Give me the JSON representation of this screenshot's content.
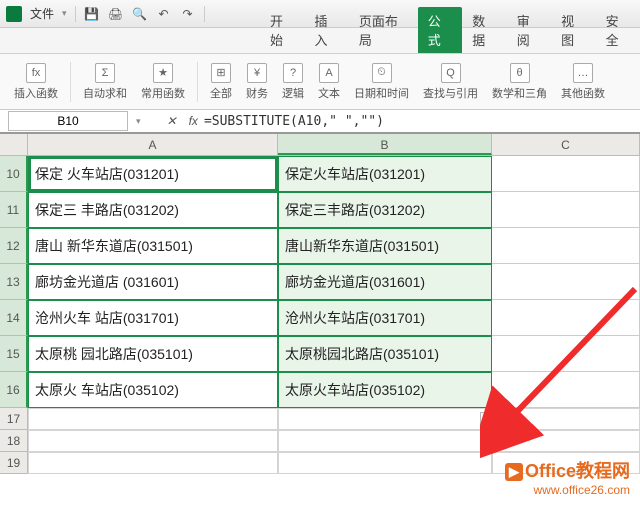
{
  "titlebar": {
    "file_label": "文件",
    "qa": {
      "save": "💾",
      "print": "🖨",
      "preview": "🔍",
      "undo": "↶",
      "redo": "↷"
    }
  },
  "ribbon_tabs": {
    "start": "开始",
    "insert": "插入",
    "layout": "页面布局",
    "formula": "公式",
    "data": "数据",
    "review": "审阅",
    "view": "视图",
    "security": "安全"
  },
  "ribbon_groups": {
    "insert_fn": {
      "icon": "fx",
      "label": "插入函数"
    },
    "autosum": {
      "icon": "Σ",
      "label": "自动求和"
    },
    "common": {
      "icon": "★",
      "label": "常用函数"
    },
    "all": {
      "icon": "⊞",
      "label": "全部"
    },
    "finance": {
      "icon": "¥",
      "label": "财务"
    },
    "logic": {
      "icon": "?",
      "label": "逻辑"
    },
    "text": {
      "icon": "A",
      "label": "文本"
    },
    "datetime": {
      "icon": "⏲",
      "label": "日期和时间"
    },
    "lookup": {
      "icon": "Q",
      "label": "查找与引用"
    },
    "math": {
      "icon": "θ",
      "label": "数学和三角"
    },
    "other": {
      "icon": "…",
      "label": "其他函数"
    }
  },
  "namebox": "B10",
  "formula": "=SUBSTITUTE(A10,\" \",\"\")",
  "columns": {
    "a": "A",
    "b": "B",
    "c": "C"
  },
  "rows": [
    {
      "n": "10",
      "a": "保定  火车站店(031201)",
      "b": "保定火车站店(031201)"
    },
    {
      "n": "11",
      "a": "保定三   丰路店(031202)",
      "b": "保定三丰路店(031202)"
    },
    {
      "n": "12",
      "a": "唐山   新华东道店(031501)",
      "b": "唐山新华东道店(031501)"
    },
    {
      "n": "13",
      "a": "廊坊金光道店   (031601)",
      "b": "廊坊金光道店(031601)"
    },
    {
      "n": "14",
      "a": "沧州火车   站店(031701)",
      "b": "沧州火车站店(031701)"
    },
    {
      "n": "15",
      "a": "太原桃    园北路店(035101)",
      "b": "太原桃园北路店(035101)"
    },
    {
      "n": "16",
      "a": "太原火   车站店(035102)",
      "b": "太原火车站店(035102)"
    }
  ],
  "empty_rows": [
    "17",
    "18",
    "19"
  ],
  "smarttag": "眠",
  "watermark": {
    "line1": "Office教程网",
    "line2": "www.office26.com"
  },
  "colors": {
    "accent": "#1a8e4a",
    "arrow": "#ef2b2b",
    "brand": "#e66a1f"
  }
}
